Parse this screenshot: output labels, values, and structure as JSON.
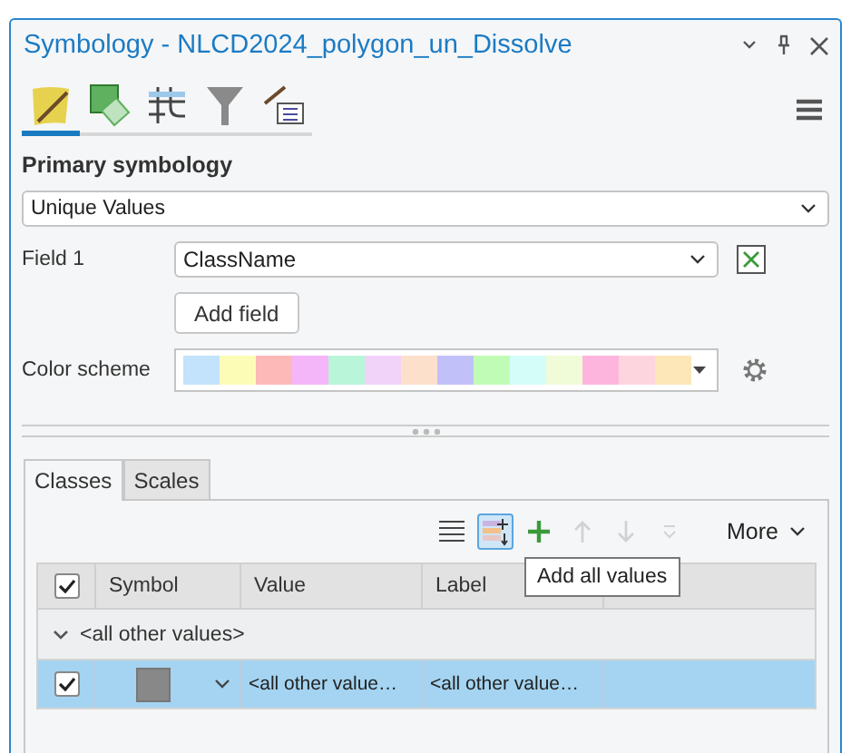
{
  "pane": {
    "title": "Symbology - NLCD2024_polygon_un_Dissolve"
  },
  "symbology_tabs": [
    {
      "kind": "primary",
      "selected": true
    },
    {
      "kind": "vary",
      "selected": false
    },
    {
      "kind": "labels",
      "selected": false
    },
    {
      "kind": "filter",
      "selected": false
    },
    {
      "kind": "attributes",
      "selected": false
    }
  ],
  "primary_symbology": {
    "label": "Primary symbology",
    "value": "Unique Values"
  },
  "field_1": {
    "label": "Field 1",
    "value": "ClassName"
  },
  "add_field": "Add field",
  "color_scheme": {
    "label": "Color scheme"
  },
  "tabs": [
    {
      "label": "Classes",
      "selected": true
    },
    {
      "label": "Scales",
      "selected": false
    }
  ],
  "tools": [
    {
      "kind": "list",
      "active": false,
      "disabled": false
    },
    {
      "kind": "add-all",
      "active": true,
      "disabled": false
    },
    {
      "kind": "add",
      "active": false,
      "disabled": false
    },
    {
      "kind": "up",
      "active": false,
      "disabled": true
    },
    {
      "kind": "down",
      "active": false,
      "disabled": true
    },
    {
      "kind": "collapse",
      "active": false,
      "disabled": true
    }
  ],
  "more": "More",
  "tooltip": "Add all values",
  "table": {
    "all_checked": true,
    "columns": [
      "Symbol",
      "Value",
      "Label"
    ],
    "group": {
      "label": "<all other values>",
      "expanded": true
    },
    "rows": [
      {
        "checked": true,
        "selected": true,
        "value": "<all other value…",
        "label": "<all other value…"
      }
    ]
  }
}
